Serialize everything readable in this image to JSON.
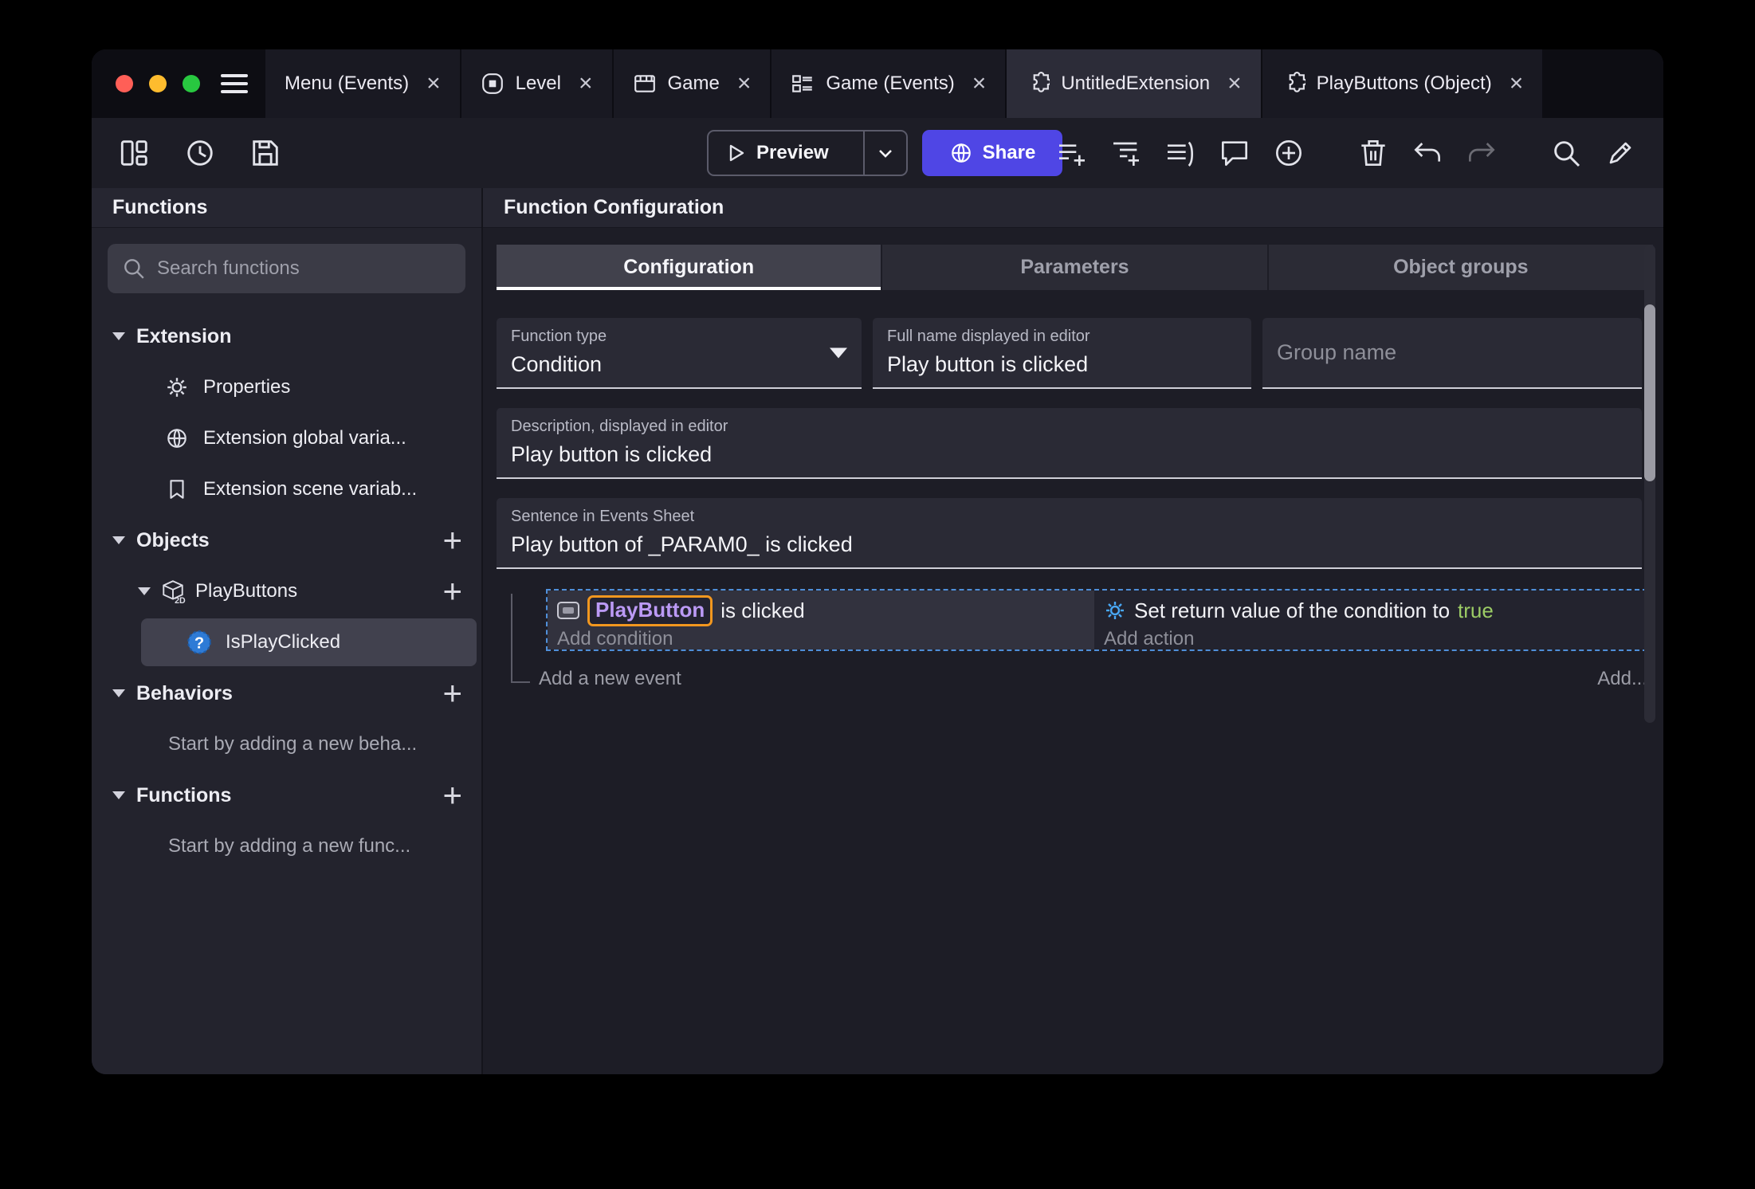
{
  "tabs": {
    "close_glyph": "×",
    "items": [
      {
        "label": "Menu (Events)"
      },
      {
        "label": "Level"
      },
      {
        "label": "Game"
      },
      {
        "label": "Game (Events)"
      },
      {
        "label": "UntitledExtension"
      },
      {
        "label": "PlayButtons (Object)"
      }
    ]
  },
  "toolbar": {
    "preview_label": "Preview",
    "share_label": "Share"
  },
  "sidebar": {
    "header": "Functions",
    "search_placeholder": "Search functions",
    "tree": {
      "extension_label": "Extension",
      "properties_label": "Properties",
      "global_vars_label": "Extension global varia...",
      "scene_vars_label": "Extension scene variab...",
      "objects_label": "Objects",
      "playbuttons_label": "PlayButtons",
      "isplayclicked_label": "IsPlayClicked",
      "behaviors_label": "Behaviors",
      "behaviors_hint": "Start by adding a new beha...",
      "functions_label": "Functions",
      "functions_hint": "Start by adding a new func...",
      "add_glyph": "+"
    }
  },
  "main": {
    "header": "Function Configuration",
    "tabs": [
      {
        "label": "Configuration"
      },
      {
        "label": "Parameters"
      },
      {
        "label": "Object groups"
      }
    ],
    "form": {
      "function_type_label": "Function type",
      "function_type_value": "Condition",
      "full_name_label": "Full name displayed in editor",
      "full_name_value": "Play button is clicked",
      "group_name_placeholder": "Group name",
      "description_label": "Description, displayed in editor",
      "description_value": "Play button is clicked",
      "sentence_label": "Sentence in Events Sheet",
      "sentence_value": "Play button of _PARAM0_ is clicked"
    },
    "events": {
      "condition_object": "PlayButton",
      "condition_suffix": " is clicked",
      "add_condition": "Add condition",
      "action_prefix": "Set return value of the condition to ",
      "action_value": "true",
      "add_action": "Add action",
      "add_new_event": "Add a new event",
      "add_more": "Add..."
    }
  },
  "colors": {
    "accent_indigo": "#4f46e5",
    "true_green": "#9ccc65",
    "object_purple": "#bb9af5",
    "chip_orange": "#f2971f",
    "selection_blue": "#4f8fd9"
  }
}
